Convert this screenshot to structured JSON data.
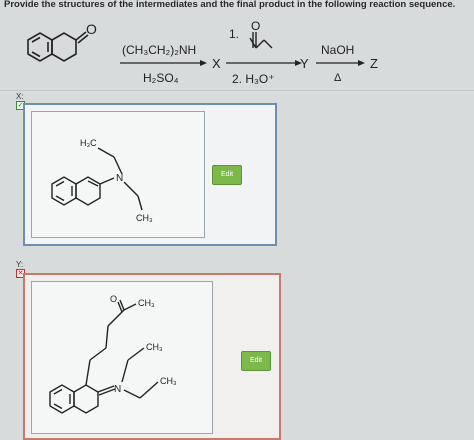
{
  "question": "Provide the structures of the intermediates and the final product in the following reaction sequence.",
  "scheme": {
    "reagent1_top": "(CH₃CH₂)₂NH",
    "reagent1_bottom": "H₂SO₄",
    "product_x": "X",
    "step2_top": "1.",
    "step2_bottom": "2. H₃O⁺",
    "product_y": "Y",
    "reagent3_top": "NaOH",
    "reagent3_bottom": "Δ",
    "product_z": "Z"
  },
  "slots": [
    {
      "label": "X:",
      "status": "correct",
      "edit_label": "Edit",
      "atoms": {
        "methyl_top": "H₃C",
        "nitrogen": "N",
        "methyl_bottom": "CH₃"
      }
    },
    {
      "label": "Y:",
      "status": "incorrect",
      "edit_label": "Edit",
      "atoms": {
        "oxygen": "O",
        "methyl_ketone": "CH₃",
        "methyl_2": "CH₃",
        "nitrogen": "N",
        "methyl_3": "CH₃"
      }
    }
  ],
  "colors": {
    "edit_button": "#7db84a",
    "correct_border": "#6a8fb0",
    "incorrect_border": "#c87a6a"
  }
}
